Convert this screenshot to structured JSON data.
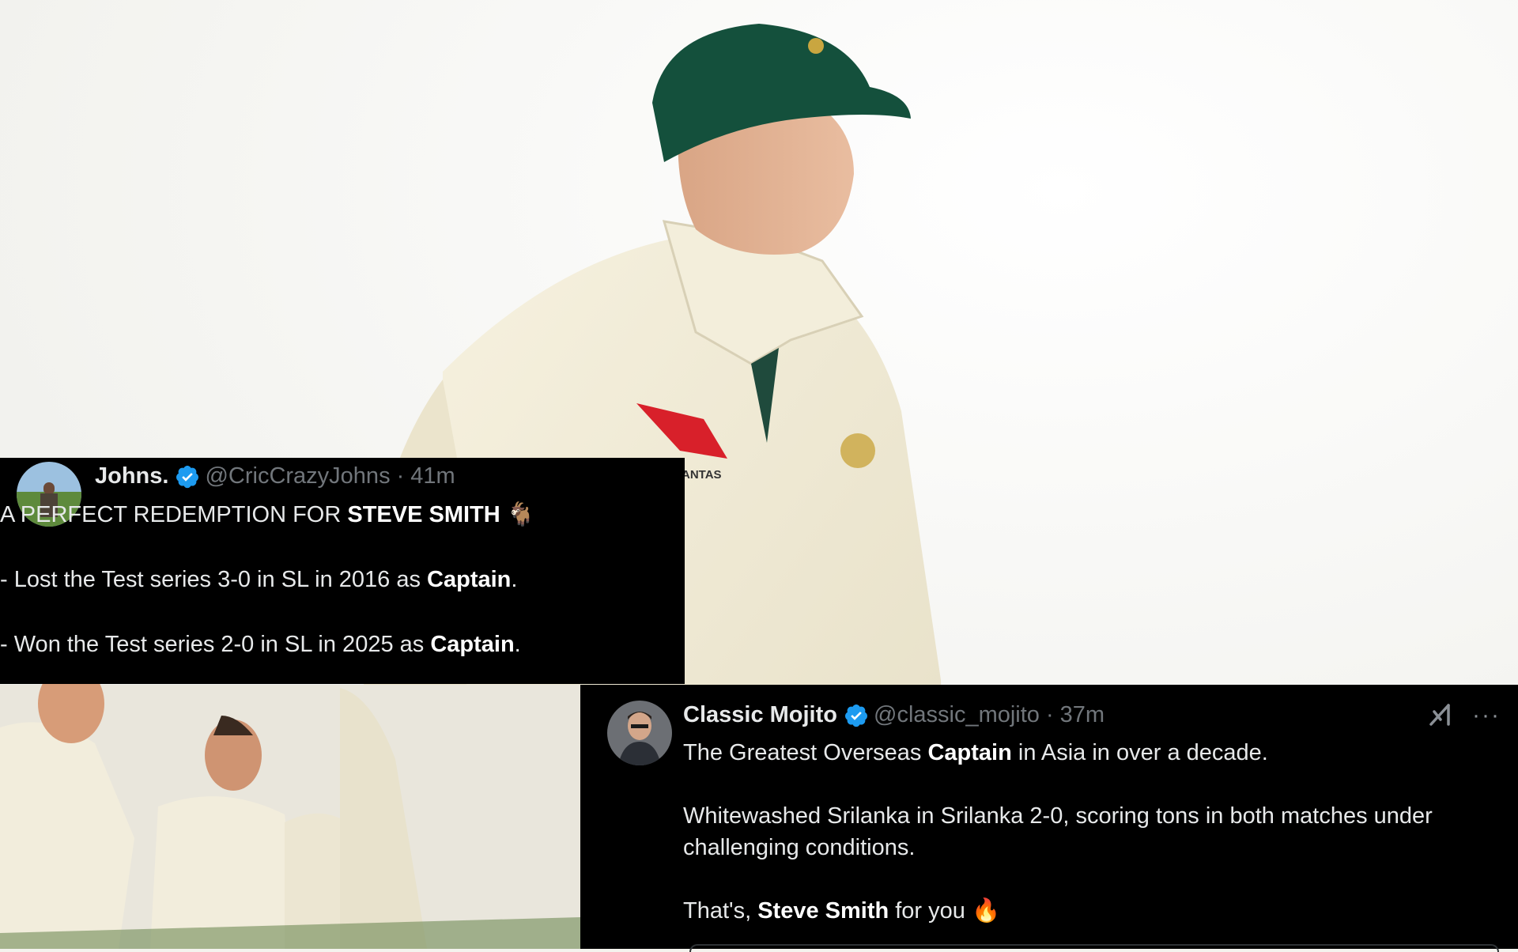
{
  "tweets": [
    {
      "name": "Johns.",
      "handle": "@CricCrazyJohns",
      "separator": "·",
      "time": "41m",
      "lines": [
        {
          "pre": "A PERFECT REDEMPTION FOR ",
          "bold": "STEVE SMITH",
          "post": " 🐐"
        },
        {
          "pre": "- Lost the Test series 3-0 in SL in 2016 as ",
          "bold": "Captain",
          "post": "."
        },
        {
          "pre": "- Won the Test series 2-0 in SL in 2025 as ",
          "bold": "Captain",
          "post": "."
        }
      ]
    },
    {
      "name": "Classic Mojito",
      "handle": "@classic_mojito",
      "separator": "·",
      "time": "37m",
      "lines": [
        {
          "pre": "The Greatest Overseas ",
          "bold": "Captain",
          "post": " in Asia in over a decade."
        },
        {
          "pre": "Whitewashed Srilanka in Srilanka 2-0, scoring tons in both matches under",
          "bold": "",
          "post": ""
        },
        {
          "pre": "challenging conditions.",
          "bold": "",
          "post": ""
        },
        {
          "pre": "That's, ",
          "bold": "Steve Smith",
          "post": " for you 🔥"
        }
      ],
      "actions": {
        "grok_icon": "grok-icon",
        "more_label": "···"
      }
    }
  ],
  "colors": {
    "card_bg": "#000000",
    "text": "#e7e9ea",
    "muted": "#71767b",
    "verified": "#1d9bf0"
  }
}
